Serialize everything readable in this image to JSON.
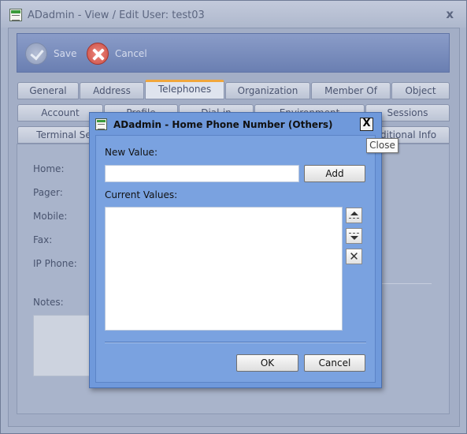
{
  "window": {
    "title": "ADadmin - View / Edit User:  test03",
    "close_glyph": "x"
  },
  "toolbar": {
    "save_label": "Save",
    "cancel_label": "Cancel"
  },
  "tabs_row1": [
    "General",
    "Address",
    "Telephones",
    "Organization",
    "Member Of",
    "Object"
  ],
  "tabs_row2": [
    "Account",
    "Profile",
    "Dial-in",
    "Environment",
    "Sessions"
  ],
  "tabs_row3": [
    "Terminal Se",
    "ditional Info"
  ],
  "active_tab": "Telephones",
  "telephones": {
    "home_label": "Home:",
    "pager_label": "Pager:",
    "mobile_label": "Mobile:",
    "fax_label": "Fax:",
    "ipphone_label": "IP Phone:",
    "notes_label": "Notes:"
  },
  "dialog": {
    "title": "ADadmin - Home Phone Number (Others)",
    "close_glyph": "X",
    "new_value_label": "New Value:",
    "new_value_input": "",
    "add_label": "Add",
    "current_values_label": "Current Values:",
    "current_values": [],
    "delete_glyph": "✕",
    "ok_label": "OK",
    "cancel_label": "Cancel"
  },
  "tooltip": {
    "text": "Close"
  }
}
